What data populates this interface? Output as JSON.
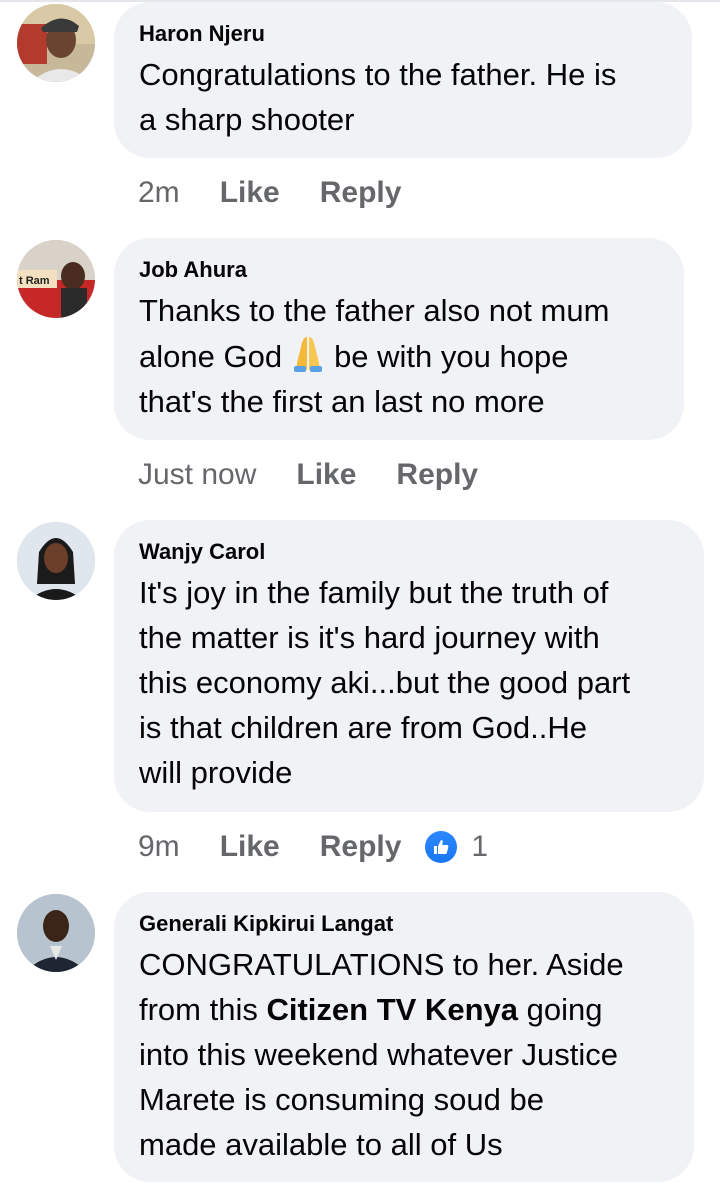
{
  "comments": [
    {
      "author": "Haron Njeru",
      "text_lines": [
        "Congratulations to the father. He is",
        "a sharp shooter"
      ],
      "time": "2m",
      "like_label": "Like",
      "reply_label": "Reply"
    },
    {
      "author": "Job Ahura",
      "text_line1": "Thanks to the father also not mum",
      "text_line2_a": "alone God",
      "emoji": "folded-hands-icon",
      "text_line2_b": "be with you hope",
      "text_line3": "that's the first an last no more",
      "time": "Just now",
      "like_label": "Like",
      "reply_label": "Reply"
    },
    {
      "author": "Wanjy Carol",
      "text_lines": [
        "It's joy in the family but the truth of",
        "the matter is it's hard journey with",
        "this economy aki...but the good part",
        "is that children are from God..He",
        "will provide"
      ],
      "time": "9m",
      "like_label": "Like",
      "reply_label": "Reply",
      "reaction_icon": "like-reaction-icon",
      "reaction_count": "1"
    },
    {
      "author": "Generali Kipkirui Langat",
      "line1": "CONGRATULATIONS to her. Aside",
      "line2_a": "from this",
      "mention": "Citizen TV Kenya",
      "line2_b": "going",
      "line3": "into this weekend whatever Justice",
      "line4": "Marete is consuming soud be",
      "line5": "made available to all of Us"
    }
  ],
  "colors": {
    "bubble": "#f0f2f5",
    "meta_text": "#65676b",
    "like_blue": "#1877f2"
  }
}
